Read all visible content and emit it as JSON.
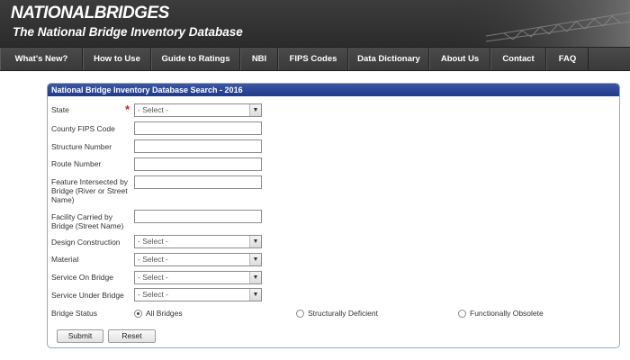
{
  "header": {
    "logo": "NATIONALBRIDGES",
    "subtitle": "The National Bridge Inventory Database"
  },
  "nav": [
    {
      "label": "What's New?"
    },
    {
      "label": "How to Use"
    },
    {
      "label": "Guide to Ratings"
    },
    {
      "label": "NBI"
    },
    {
      "label": "FIPS Codes"
    },
    {
      "label": "Data Dictionary"
    },
    {
      "label": "About Us"
    },
    {
      "label": "Contact"
    },
    {
      "label": "FAQ"
    }
  ],
  "form": {
    "title": "National Bridge Inventory Database Search - 2016",
    "required_mark": "*",
    "state": {
      "label": "State",
      "value": "- Select -"
    },
    "county": {
      "label": "County FIPS Code",
      "value": ""
    },
    "structure": {
      "label": "Structure Number",
      "value": ""
    },
    "route": {
      "label": "Route Number",
      "value": ""
    },
    "feature": {
      "label": "Feature Intersected by Bridge (River or Street Name)",
      "value": ""
    },
    "facility": {
      "label": "Facility Carried by Bridge (Street Name)",
      "value": ""
    },
    "design": {
      "label": "Design Construction",
      "value": "- Select -"
    },
    "material": {
      "label": "Material",
      "value": "- Select -"
    },
    "service_on": {
      "label": "Service On Bridge",
      "value": "- Select -"
    },
    "service_under": {
      "label": "Service Under Bridge",
      "value": "- Select -"
    },
    "status": {
      "label": "Bridge Status",
      "options": [
        "All Bridges",
        "Structurally Deficient",
        "Functionally Obsolete"
      ],
      "selected": "All Bridges"
    },
    "submit_label": "Submit",
    "reset_label": "Reset"
  },
  "colors": {
    "header_bg": "#333333",
    "panel_title_bg": "#2a469a",
    "required": "#d62020"
  }
}
